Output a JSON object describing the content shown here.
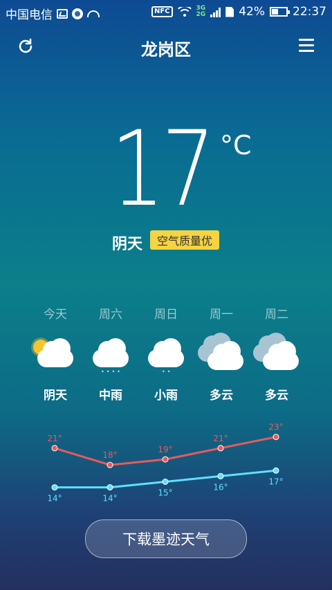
{
  "status_bar": {
    "carrier": "中国电信",
    "nfc": "NFC",
    "net_top": "3G",
    "net_bottom": "2G",
    "battery": "42%",
    "battery_level": 0.42,
    "time": "22:37"
  },
  "header": {
    "title": "龙岗区",
    "refresh_icon": "refresh-icon",
    "menu_icon": "menu-icon"
  },
  "current": {
    "temperature": "17",
    "unit": "°C",
    "condition": "阴天",
    "air_quality": "空气质量优"
  },
  "colors": {
    "high_line": "#e65b5b",
    "low_line": "#5fe0ff",
    "aqi_badge": "#f6d341"
  },
  "forecast": [
    {
      "day": "今天",
      "condition": "阴天",
      "icon": "partly-cloudy-icon",
      "high": "21°",
      "low": "14°"
    },
    {
      "day": "周六",
      "condition": "中雨",
      "icon": "moderate-rain-icon",
      "high": "18°",
      "low": "14°"
    },
    {
      "day": "周日",
      "condition": "小雨",
      "icon": "light-rain-icon",
      "high": "19°",
      "low": "15°"
    },
    {
      "day": "周一",
      "condition": "多云",
      "icon": "cloudy-icon",
      "high": "21°",
      "low": "16°"
    },
    {
      "day": "周二",
      "condition": "多云",
      "icon": "cloudy-icon",
      "high": "23°",
      "low": "17°"
    }
  ],
  "download_button": "下载墨迹天气"
}
